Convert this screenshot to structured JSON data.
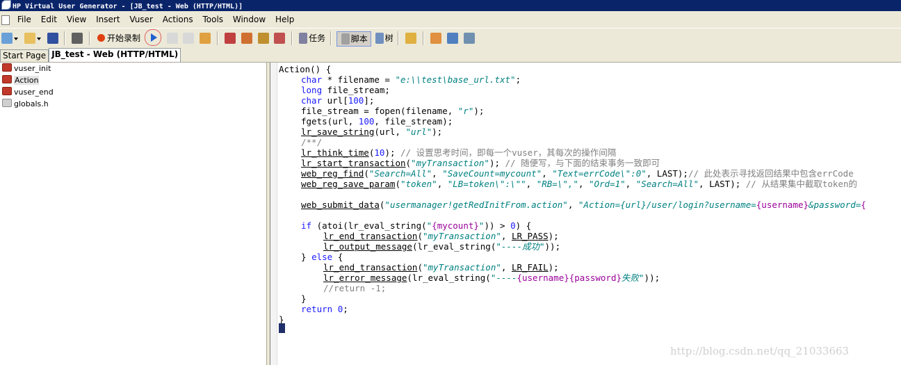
{
  "window": {
    "title": "HP Virtual User Generator - [JB_test - Web (HTTP/HTML)]"
  },
  "menu": [
    "File",
    "Edit",
    "View",
    "Insert",
    "Vuser",
    "Actions",
    "Tools",
    "Window",
    "Help"
  ],
  "toolbar": {
    "record_label": "开始录制",
    "tasks_label": "任务",
    "script_label": "脚本",
    "tree_label": "树"
  },
  "tabs": {
    "start_page": "Start Page",
    "current": "JB_test - Web (HTTP/HTML)"
  },
  "tree": {
    "items": [
      "vuser_init",
      "Action",
      "vuser_end",
      "globals.h"
    ],
    "selected": "Action"
  },
  "code": {
    "l0": "Action() {",
    "l1a": "char",
    "l1b": " * filename = ",
    "l1c": "\"e:\\\\test\\base_url.txt\"",
    "l1d": ";",
    "l2a": "long",
    "l2b": " file_stream;",
    "l3a": "char",
    "l3b": " url[",
    "l3c": "100",
    "l3d": "];",
    "l4a": "file_stream = fopen(filename, ",
    "l4b": "\"r\"",
    "l4c": ");",
    "l5a": "fgets(url, ",
    "l5b": "100",
    "l5c": ", file_stream);",
    "l6a": "lr_save_string",
    "l6b": "(url, ",
    "l6c": "\"url\"",
    "l6d": ");",
    "l7": "/**/",
    "l8a": "lr_think_time",
    "l8b": "(",
    "l8c": "10",
    "l8d": "); ",
    "l8e": "// 设置思考时间，即每一个vuser，其每次的操作间隔",
    "l9a": "lr_start_transaction",
    "l9b": "(",
    "l9c": "\"myTransaction\"",
    "l9d": "); ",
    "l9e": "// 随便写，与下面的结束事务一致即可",
    "l10a": "web_reg_find",
    "l10b": "(",
    "l10c": "\"Search=All\"",
    "l10d": ", ",
    "l10e": "\"SaveCount=mycount\"",
    "l10f": ", ",
    "l10g": "\"Text=errCode\\\":0\"",
    "l10h": ", LAST);",
    "l10i": "// 此处表示寻找返回结果中包含errCode",
    "l11a": "web_reg_save_param",
    "l11b": "(",
    "l11c": "\"token\"",
    "l11d": ", ",
    "l11e": "\"LB=token\\\":\\\"\"",
    "l11f": ", ",
    "l11g": "\"RB=\\\",\"",
    "l11h": ", ",
    "l11i": "\"Ord=1\"",
    "l11j": ", ",
    "l11k": "\"Search=All\"",
    "l11l": ", LAST); ",
    "l11m": "// 从结果集中截取token的",
    "l13a": "web_submit_data",
    "l13b": "(",
    "l13c": "\"usermanager!getRedInitFrom.action\"",
    "l13d": ", ",
    "l13e": "\"Action={url}/user/login?username=",
    "l13f": "{username}",
    "l13g": "&password=",
    "l13h": "{",
    "l15a": "if",
    "l15b": " (atoi(lr_eval_string(",
    "l15c": "\"",
    "l15d": "{mycount}",
    "l15e": "\"",
    "l15f": ")) > ",
    "l15g": "0",
    "l15h": ") {",
    "l16a": "lr_end_transaction",
    "l16b": "(",
    "l16c": "\"myTransaction\"",
    "l16d": ", ",
    "l16e": "LR_PASS",
    "l16f": ");",
    "l17a": "lr_output_message",
    "l17b": "(lr_eval_string(",
    "l17c": "\"----成功\"",
    "l17d": "));",
    "l18a": "} ",
    "l18b": "else",
    "l18c": " {",
    "l19a": "lr_end_transaction",
    "l19b": "(",
    "l19c": "\"myTransaction\"",
    "l19d": ", ",
    "l19e": "LR_FAIL",
    "l19f": ");",
    "l20a": "lr_error_message",
    "l20b": "(lr_eval_string(",
    "l20c": "\"----",
    "l20d": "{username}",
    "l20e": "{password}",
    "l20f": "失败\"",
    "l20g": "));",
    "l21": "//return -1;",
    "l22": "}",
    "l23a": "return",
    "l23b": " ",
    "l23c": "0",
    "l23d": ";",
    "l24": "}"
  },
  "watermark": "http://blog.csdn.net/qq_21033663",
  "colors": {
    "keyword": "#1a1aff",
    "string": "#008080",
    "comment": "#808080",
    "param": "#9a009a",
    "titlebar": "#0a246a"
  }
}
